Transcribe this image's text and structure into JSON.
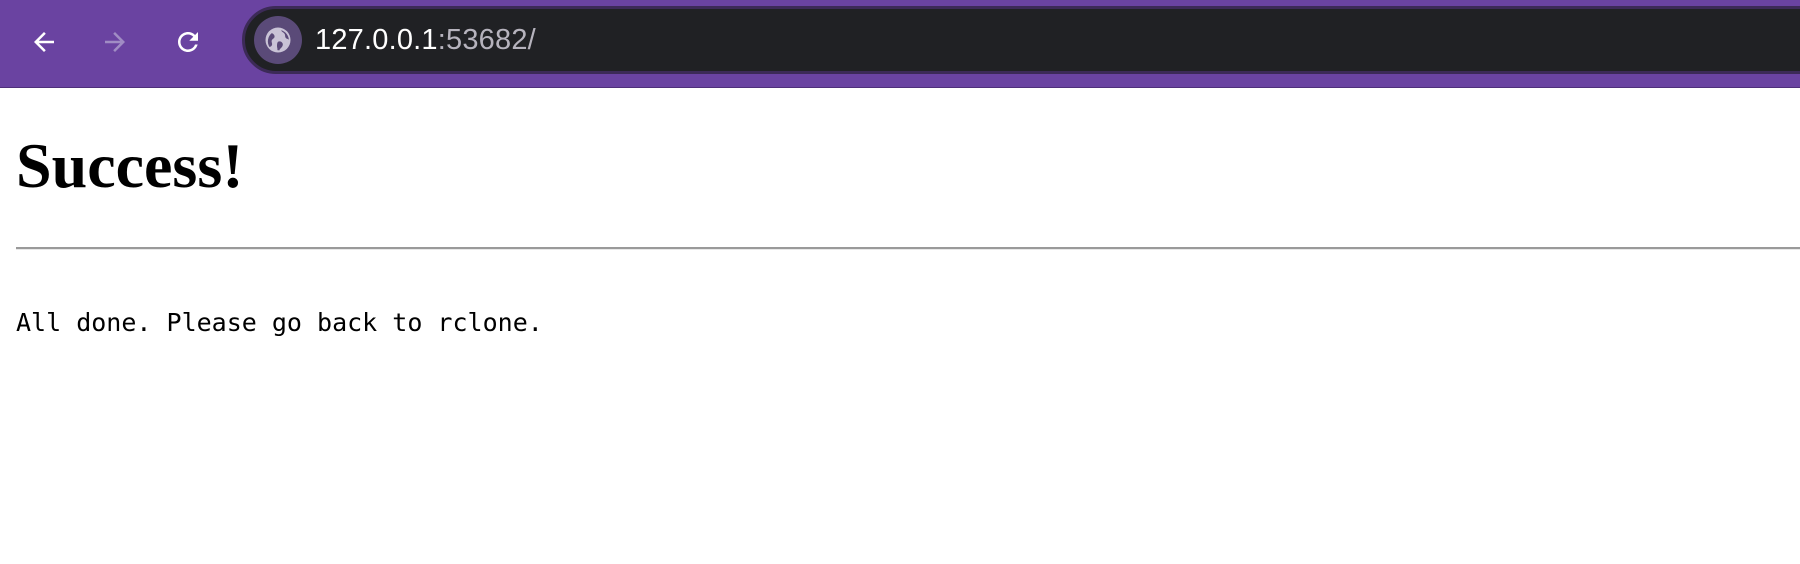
{
  "browser": {
    "url_host": "127.0.0.1",
    "url_rest": ":53682/",
    "site_icon": "globe-icon",
    "toolbar_color": "#6a43a1",
    "back_icon": "arrow-left-icon",
    "forward_icon": "arrow-right-icon",
    "reload_icon": "reload-icon"
  },
  "page": {
    "heading": "Success!",
    "message": "All done. Please go back to rclone."
  }
}
